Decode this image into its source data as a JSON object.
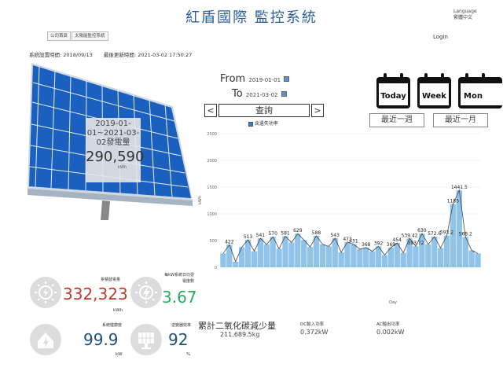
{
  "header": {
    "title": "紅盾國際 監控系統",
    "language_label": "Language",
    "language_value": "繁體中文",
    "login": "Login"
  },
  "nav": {
    "home": "公司首頁",
    "solar": "太陽能監控系統"
  },
  "info": {
    "install_label": "系統設置時間:",
    "install_date": "2018/09/13",
    "update_label": "最後更新時間:",
    "update_time": "2021-03-02 17:50:27"
  },
  "summary": {
    "label": "2019-01-01~2021-03-02發電量",
    "value": "290,590",
    "unit": "kWh"
  },
  "query": {
    "from_label": "From",
    "from_date": "2019-01-01",
    "to_label": "To",
    "to_date": "2021-03-02",
    "prev": "<",
    "next": ">",
    "submit": "查詢",
    "checkbox_label": "含遺失功率",
    "checked": true
  },
  "calendars": [
    {
      "label": "Today"
    },
    {
      "label": "Week"
    },
    {
      "label": "Mon"
    }
  ],
  "ranges": {
    "week": "最近一週",
    "month": "最近一月"
  },
  "stats": {
    "total_label": "累積發電量",
    "total_value": "332,323",
    "total_unit": "kWh",
    "avg_label": "每kW系統日均發電度數",
    "avg_value": "3.67",
    "sys_label": "系統健康度",
    "sys_value": "99.9",
    "sys_unit": "kW",
    "inv_label": "逆變器效率",
    "inv_value": "92",
    "inv_unit": "%",
    "carbon_label": "累計二氧化碳減少量",
    "carbon_value": "211,689.5kg",
    "dc_label": "DC輸入功率",
    "dc_value": "0.372kW",
    "ac_label": "AC輸出功率",
    "ac_value": "0.002kW"
  },
  "colors": {
    "title": "#2a5f9e",
    "total": "#c0392b",
    "avg": "#27ae60",
    "sys": "#1f4e79",
    "inv": "#1f4e79",
    "bar": "#8fc3ea",
    "line": "#444444"
  },
  "chart_data": {
    "type": "bar",
    "ylabel": "kWh",
    "xlabel": "Day",
    "ylim": [
      0,
      2500
    ],
    "yticks": [
      0,
      500,
      1000,
      1500,
      2000,
      2500
    ],
    "annotations": [
      {
        "label": "1185",
        "value": 1185
      },
      {
        "label": "1441.5",
        "value": 1441.5
      },
      {
        "label": "422",
        "value": 422
      },
      {
        "label": "513",
        "value": 513
      },
      {
        "label": "541",
        "value": 541
      },
      {
        "label": "570",
        "value": 570
      },
      {
        "label": "581",
        "value": 581
      },
      {
        "label": "629",
        "value": 629
      },
      {
        "label": "588",
        "value": 588
      },
      {
        "label": "543",
        "value": 543
      },
      {
        "label": "473",
        "value": 473
      },
      {
        "label": "431",
        "value": 431
      },
      {
        "label": "368",
        "value": 368
      },
      {
        "label": "392",
        "value": 392
      },
      {
        "label": "369",
        "value": 369
      },
      {
        "label": "454",
        "value": 454
      },
      {
        "label": "539.42",
        "value": 539.42
      },
      {
        "label": "630",
        "value": 630
      },
      {
        "label": "572.6",
        "value": 572.6
      },
      {
        "label": "593.2",
        "value": 593.2
      },
      {
        "label": "568.2",
        "value": 568.2
      },
      {
        "label": "393.72",
        "value": 393.72
      }
    ],
    "values": [
      260,
      422,
      104,
      377,
      513,
      300,
      541,
      426,
      570,
      347,
      581,
      464,
      629,
      510,
      380,
      588,
      429,
      391,
      543,
      280,
      473,
      431,
      340,
      368,
      300,
      392,
      228,
      369,
      454,
      270,
      539.42,
      393.72,
      630,
      429,
      572.6,
      360,
      593.2,
      1185,
      1441.5,
      568.2,
      315.8,
      260
    ]
  }
}
